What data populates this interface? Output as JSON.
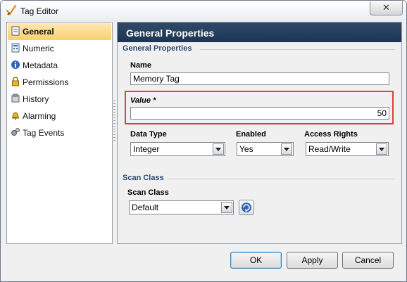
{
  "window": {
    "title": "Tag Editor",
    "close_glyph": "✕"
  },
  "nav": {
    "items": [
      {
        "label": "General",
        "icon": "general-icon",
        "selected": true
      },
      {
        "label": "Numeric",
        "icon": "numeric-icon"
      },
      {
        "label": "Metadata",
        "icon": "info-icon"
      },
      {
        "label": "Permissions",
        "icon": "lock-icon"
      },
      {
        "label": "History",
        "icon": "history-icon"
      },
      {
        "label": "Alarming",
        "icon": "bell-icon"
      },
      {
        "label": "Tag Events",
        "icon": "events-icon"
      }
    ]
  },
  "panel": {
    "header": "General Properties",
    "general_group": {
      "title": "General Properties",
      "name_label": "Name",
      "name_value": "Memory Tag",
      "value_label": "Value *",
      "value_value": "50",
      "data_type_label": "Data Type",
      "data_type_value": "Integer",
      "enabled_label": "Enabled",
      "enabled_value": "Yes",
      "access_rights_label": "Access Rights",
      "access_rights_value": "Read/Write"
    },
    "scan_group": {
      "title": "Scan Class",
      "scan_class_label": "Scan Class",
      "scan_class_value": "Default"
    }
  },
  "buttons": {
    "ok": "OK",
    "apply": "Apply",
    "cancel": "Cancel"
  },
  "colors": {
    "header_bg": "#1d3552",
    "selection": "#f8cf6f",
    "highlight_border": "#e04040",
    "group_title": "#2e4b74"
  }
}
